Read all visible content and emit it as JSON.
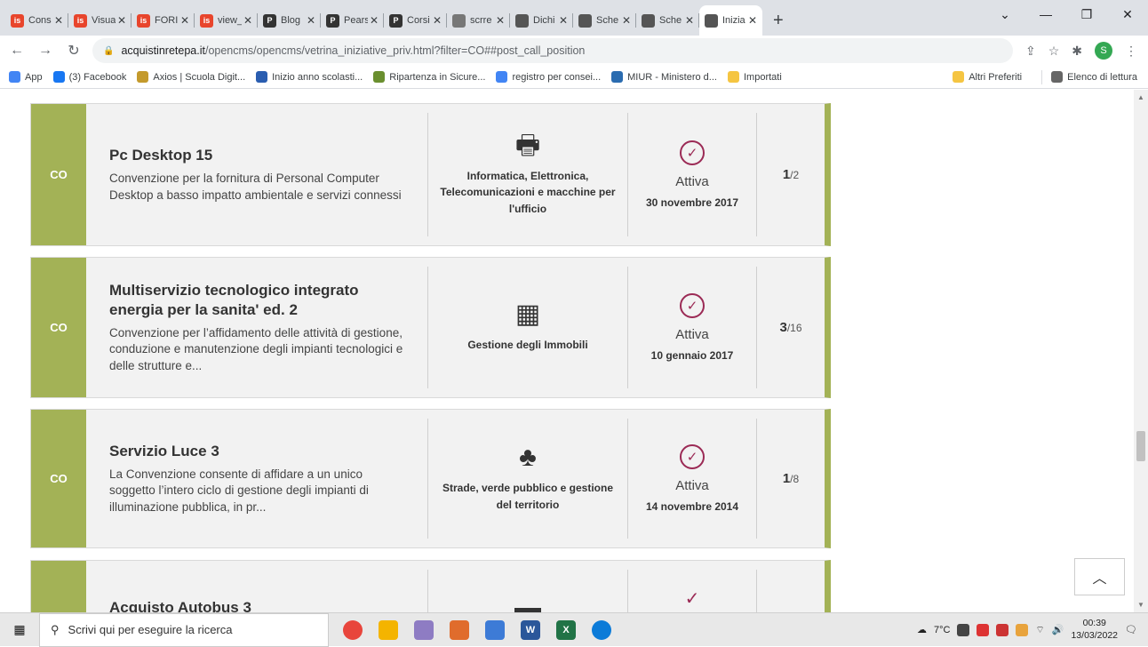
{
  "browser": {
    "tabs": [
      {
        "label": "Cons",
        "fav_color": "#e8452c",
        "fav_text": "is",
        "active": false
      },
      {
        "label": "Visua",
        "fav_color": "#e8452c",
        "fav_text": "is",
        "active": false
      },
      {
        "label": "FORI",
        "fav_color": "#e8452c",
        "fav_text": "is",
        "active": false
      },
      {
        "label": "view_",
        "fav_color": "#e8452c",
        "fav_text": "is",
        "active": false
      },
      {
        "label": "Blog",
        "fav_color": "#333333",
        "fav_text": "P",
        "active": false
      },
      {
        "label": "Pears",
        "fav_color": "#333333",
        "fav_text": "P",
        "active": false
      },
      {
        "label": "Corsi",
        "fav_color": "#333333",
        "fav_text": "P",
        "active": false
      },
      {
        "label": "scrre",
        "fav_color": "#777777",
        "fav_text": "",
        "active": false
      },
      {
        "label": "Dichi",
        "fav_color": "#555555",
        "fav_text": "",
        "active": false
      },
      {
        "label": "Sche",
        "fav_color": "#555555",
        "fav_text": "",
        "active": false
      },
      {
        "label": "Sche",
        "fav_color": "#555555",
        "fav_text": "",
        "active": false
      },
      {
        "label": "Inizia",
        "fav_color": "#555555",
        "fav_text": "",
        "active": true
      }
    ],
    "url_host": "acquistinretepa.it",
    "url_path": "/opencms/opencms/vetrina_iniziative_priv.html?filter=CO##post_call_position",
    "profile_initial": "S",
    "bookmarks": [
      {
        "label": "App",
        "color": "#4285f4"
      },
      {
        "label": "(3) Facebook",
        "color": "#1877f2"
      },
      {
        "label": "Axios | Scuola Digit...",
        "color": "#c49a2c"
      },
      {
        "label": "Inizio anno scolasti...",
        "color": "#2a5db0"
      },
      {
        "label": "Ripartenza in Sicure...",
        "color": "#6a8f2f"
      },
      {
        "label": "registro per consei...",
        "color": "#4285f4"
      },
      {
        "label": "MIUR - Ministero d...",
        "color": "#2b6cb0"
      },
      {
        "label": "Importati",
        "color": "#f5c542"
      }
    ],
    "bookmarks_right": [
      {
        "label": "Altri Preferiti",
        "color": "#f5c542"
      },
      {
        "label": "Elenco di lettura",
        "color": "#666666"
      }
    ]
  },
  "cards": [
    {
      "tag": "CO",
      "title": "Pc Desktop 15",
      "description": "Convenzione per la fornitura di Personal Computer Desktop a basso impatto ambientale e servizi connessi",
      "category_icon": "printer-icon",
      "category_glyph": "🖶",
      "category": "Informatica, Elettronica, Telecomunicazioni e macchine per l'ufficio",
      "status": "Attiva",
      "date": "30 novembre 2017",
      "lots_active": "1",
      "lots_total": "/2"
    },
    {
      "tag": "CO",
      "title": "Multiservizio tecnologico integrato energia per la sanita' ed. 2",
      "description": "Convenzione per l’affidamento delle attività di gestione, conduzione e manutenzione degli impianti tecnologici e delle strutture e...",
      "category_icon": "building-icon",
      "category_glyph": "▦",
      "category": "Gestione degli Immobili",
      "status": "Attiva",
      "date": "10 gennaio 2017",
      "lots_active": "3",
      "lots_total": "/16"
    },
    {
      "tag": "CO",
      "title": "Servizio Luce 3",
      "description": "La Convenzione consente di affidare a un unico soggetto l’intero ciclo di gestione degli impianti di illuminazione pubblica, in pr...",
      "category_icon": "road-trees-icon",
      "category_glyph": "♣",
      "category": "Strade, verde pubblico e gestione del territorio",
      "status": "Attiva",
      "date": "14 novembre 2014",
      "lots_active": "1",
      "lots_total": "/8"
    },
    {
      "tag": "",
      "title": "Acquisto Autobus 3",
      "description": "",
      "category_icon": "bus-icon",
      "category_glyph": "▬",
      "category": "",
      "status": "",
      "date": "",
      "lots_active": "",
      "lots_total": ""
    }
  ],
  "taskbar": {
    "search_placeholder": "Scrivi qui per eseguire la ricerca",
    "weather": "7°C",
    "time": "00:39",
    "date": "13/03/2022"
  }
}
